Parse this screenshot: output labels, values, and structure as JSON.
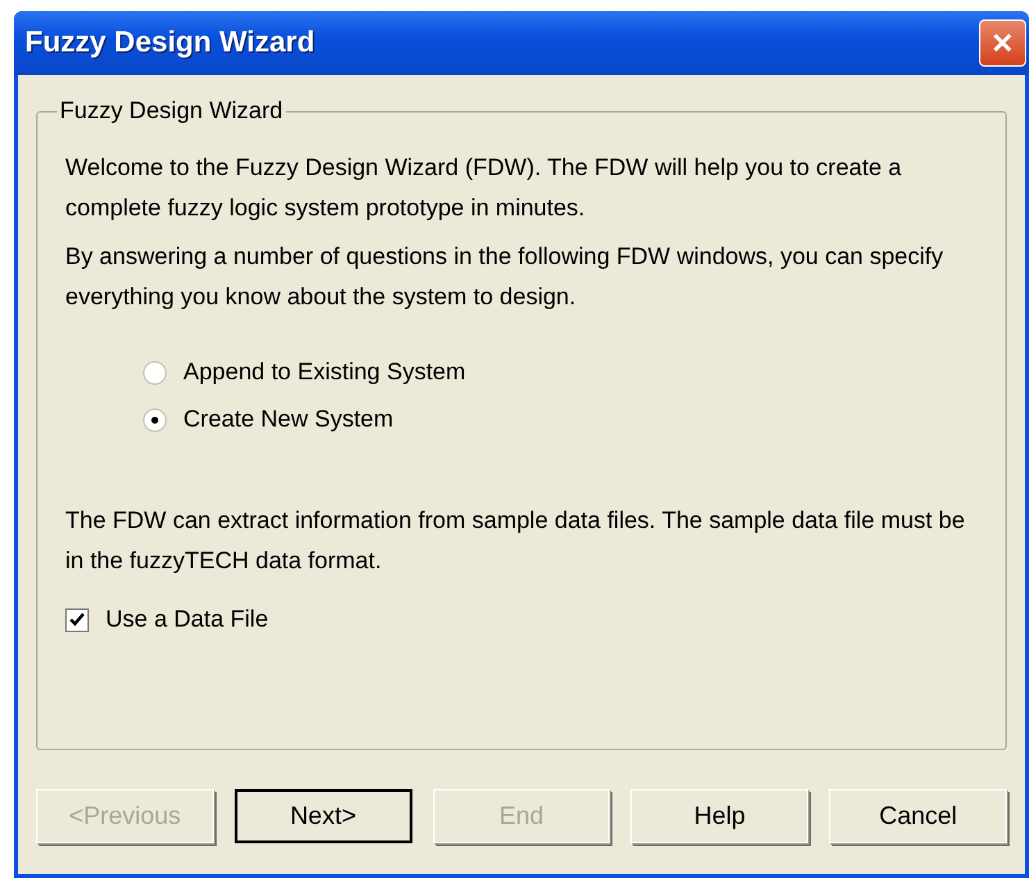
{
  "window": {
    "title": "Fuzzy Design Wizard",
    "close": "✕"
  },
  "group": {
    "title": "Fuzzy Design Wizard",
    "intro": [
      "Welcome to the Fuzzy Design Wizard (FDW). The FDW will help you to create a complete fuzzy logic system prototype in minutes.",
      "By answering a number of questions in the following FDW windows, you can specify everything you know about the system to design."
    ],
    "options": [
      {
        "label": "Append to Existing System",
        "selected": false
      },
      {
        "label": "Create New System",
        "selected": true
      }
    ],
    "data_note": "The FDW can extract information from sample data files. The sample data file must be in the fuzzyTECH data format.",
    "checkbox": {
      "label": "Use a Data File",
      "checked": true
    }
  },
  "buttons": [
    {
      "label": "<Previous",
      "disabled": true,
      "default": false
    },
    {
      "label": "Next>",
      "disabled": false,
      "default": true
    },
    {
      "label": "End",
      "disabled": true,
      "default": false
    },
    {
      "label": "Help",
      "disabled": false,
      "default": false
    },
    {
      "label": "Cancel",
      "disabled": false,
      "default": false
    }
  ]
}
